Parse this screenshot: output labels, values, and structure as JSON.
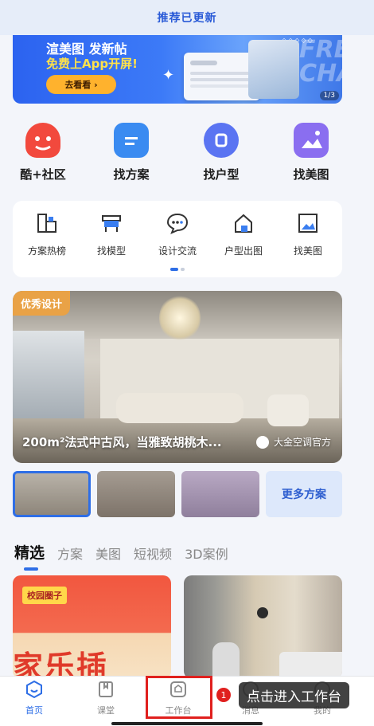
{
  "topbar": {
    "title": "推荐已更新"
  },
  "banner": {
    "title": "渲美图 发新帖",
    "subtitle": "免费上App开屏!",
    "button_label": "去看看 ›",
    "bg_text": "FREE CHA",
    "pager": "1/3"
  },
  "quick_actions": [
    {
      "label": "酷+社区",
      "icon": "community-icon",
      "color": "#f2493d"
    },
    {
      "label": "找方案",
      "icon": "document-icon",
      "color": "#3a8bf1"
    },
    {
      "label": "找户型",
      "icon": "floorplan-icon",
      "color": "#5a74f2"
    },
    {
      "label": "找美图",
      "icon": "gallery-icon",
      "color": "#8a6ef0"
    }
  ],
  "tools": [
    {
      "label": "方案热榜",
      "icon": "ranking-icon"
    },
    {
      "label": "找模型",
      "icon": "model-icon"
    },
    {
      "label": "设计交流",
      "icon": "chat-icon"
    },
    {
      "label": "户型出图",
      "icon": "house-icon"
    },
    {
      "label": "找美图",
      "icon": "picture-icon"
    }
  ],
  "feature": {
    "tag": "优秀设计",
    "caption": "200m²法式中古风，当雅致胡桃木...",
    "author": "大金空调官方"
  },
  "more_plans": "更多方案",
  "content_tabs": [
    "精选",
    "方案",
    "美图",
    "短视频",
    "3D案例"
  ],
  "cards": {
    "card1_badge": "校园圈子",
    "card1_text": "家乐插"
  },
  "bottom_nav": [
    {
      "label": "首页",
      "icon": "home-icon",
      "active": true
    },
    {
      "label": "课堂",
      "icon": "classroom-icon",
      "active": false
    },
    {
      "label": "工作台",
      "icon": "workbench-icon",
      "active": false
    },
    {
      "label": "消息",
      "icon": "message-icon",
      "active": false
    },
    {
      "label": "我的",
      "icon": "profile-icon",
      "active": false
    }
  ],
  "guide": {
    "step": "1",
    "text": "点击进入工作台"
  },
  "colors": {
    "accent": "#2e6ee6",
    "highlight": "#e0201e"
  }
}
